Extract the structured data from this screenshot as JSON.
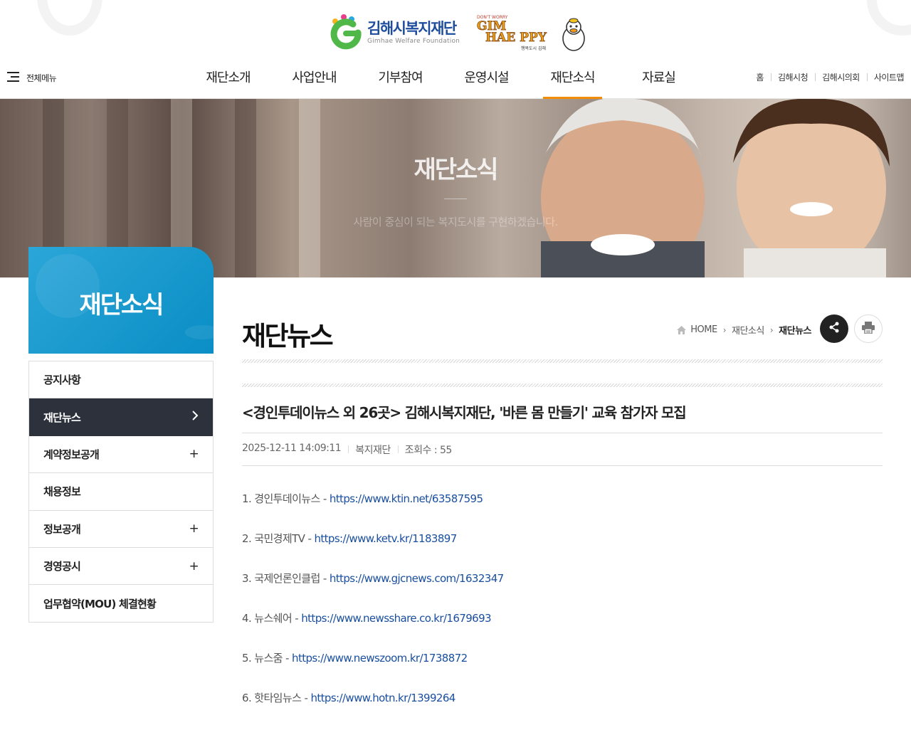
{
  "header": {
    "logo_ko": "김해시복지재단",
    "logo_en": "Gimhae Welfare Foundation",
    "brand_small": "DON'T WORRY",
    "brand_main_1": "GIM",
    "brand_main_2": "HAE PPY",
    "brand_sub": "행복도시 김해",
    "all_menu_label": "전체메뉴",
    "gnb": [
      {
        "label": "재단소개",
        "active": false
      },
      {
        "label": "사업안내",
        "active": false
      },
      {
        "label": "기부참여",
        "active": false
      },
      {
        "label": "운영시설",
        "active": false
      },
      {
        "label": "재단소식",
        "active": true
      },
      {
        "label": "자료실",
        "active": false
      }
    ],
    "util": [
      "홈",
      "김해시청",
      "김해시의회",
      "사이트맵"
    ],
    "accent_color": "#f28c00"
  },
  "visual": {
    "title": "재단소식",
    "subtitle": "사람이 중심이 되는 복지도시를 구현하겠습니다."
  },
  "lnb": {
    "title": "재단소식",
    "items": [
      {
        "label": "공지사항",
        "icon": "",
        "active": false
      },
      {
        "label": "재단뉴스",
        "icon": "chevron-right-icon",
        "active": true
      },
      {
        "label": "계약정보공개",
        "icon": "plus-icon",
        "active": false
      },
      {
        "label": "채용정보",
        "icon": "",
        "active": false
      },
      {
        "label": "정보공개",
        "icon": "plus-icon",
        "active": false
      },
      {
        "label": "경영공시",
        "icon": "plus-icon",
        "active": false
      },
      {
        "label": "업무협약(MOU) 체결현황",
        "icon": "",
        "active": false
      }
    ]
  },
  "content": {
    "page_title": "재단뉴스",
    "breadcrumb": [
      "HOME",
      "재단소식",
      "재단뉴스"
    ],
    "post": {
      "title": "<경인투데이뉴스 외 26곳> 김해시복지재단, '바른 몸 만들기' 교육 참가자 모집",
      "date": "2025-12-11 14:09:11",
      "author": "복지재단",
      "views": "조회수 : 55",
      "news": [
        {
          "prefix": "1. 경인투데이뉴스 - ",
          "url": "https://www.ktin.net/63587595"
        },
        {
          "prefix": "2. 국민경제TV - ",
          "url": "https://www.ketv.kr/1183897"
        },
        {
          "prefix": "3. 국제언론인클럽 - ",
          "url": "https://www.gjcnews.com/1632347"
        },
        {
          "prefix": "4. 뉴스쉐어 - ",
          "url": "https://www.newsshare.co.kr/1679693"
        },
        {
          "prefix": "5. 뉴스줌 - ",
          "url": "https://www.newszoom.kr/1738872"
        },
        {
          "prefix": "6. 핫타임뉴스 - ",
          "url": "https://www.hotn.kr/1399264"
        }
      ]
    }
  }
}
